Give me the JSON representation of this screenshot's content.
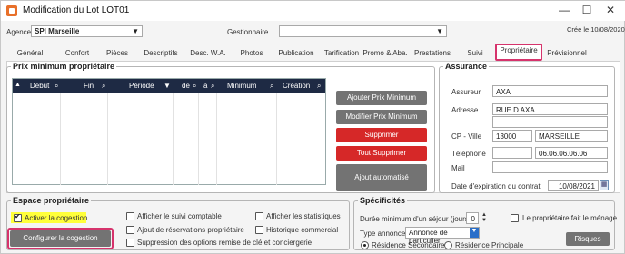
{
  "window": {
    "title": "Modification du Lot LOT01",
    "minimize": "—",
    "maximize": "☐",
    "close": "✕",
    "created": "Crée le 10/08/2020"
  },
  "header": {
    "agence_label": "Agence",
    "agence_value": "SPI Marseille",
    "gestionnaire_label": "Gestionnaire",
    "gestionnaire_value": ""
  },
  "tabs": [
    "Général",
    "Confort",
    "Pièces",
    "Descriptifs",
    "Desc. W.A.",
    "Photos",
    "Publication",
    "Tarification",
    "Promo & Aba.",
    "Prestations",
    "Suivi",
    "Propriétaire",
    "Prévisionnel"
  ],
  "active_tab": "Propriétaire",
  "prix": {
    "legend": "Prix minimum propriétaire",
    "columns": [
      "Début",
      "Fin",
      "Période",
      "de",
      "à",
      "Minimum",
      "Création"
    ],
    "buttons": {
      "ajouter": "Ajouter Prix Minimum",
      "modifier": "Modifier Prix Minimum",
      "supprimer": "Supprimer",
      "tout_supprimer": "Tout Supprimer",
      "ajout_auto": "Ajout automatisé"
    }
  },
  "assurance": {
    "legend": "Assurance",
    "assureur_label": "Assureur",
    "assureur": "AXA",
    "adresse_label": "Adresse",
    "adresse1": "RUE D AXA",
    "adresse2": "",
    "cp_label": "CP - Ville",
    "cp": "13000",
    "ville": "MARSEILLE",
    "tel_label": "Téléphone",
    "tel_prefix": "",
    "tel": "06.06.06.06.06",
    "mail_label": "Mail",
    "mail": "",
    "expiration_label": "Date d'expiration du contrat",
    "expiration": "10/08/2021"
  },
  "espace": {
    "legend": "Espace propriétaire",
    "activer": "Activer la cogestion",
    "configurer": "Configurer la cogestion",
    "suivi_comptable": "Afficher le suivi comptable",
    "statistiques": "Afficher les statistiques",
    "ajout_reservations": "Ajout de réservations propriétaire",
    "historique": "Historique commercial",
    "suppression": "Suppression des options remise de clé et conciergerie"
  },
  "specificites": {
    "legend": "Spécificités",
    "duree_label": "Durée minimum d'un séjour (jours)",
    "duree": "0",
    "menage": "Le propriétaire fait le ménage",
    "type_label": "Type annonce",
    "type_value": "Annonce de particulier",
    "residence_secondaire": "Résidence Secondaire",
    "residence_principale": "Résidence Principale",
    "risques": "Risques"
  }
}
